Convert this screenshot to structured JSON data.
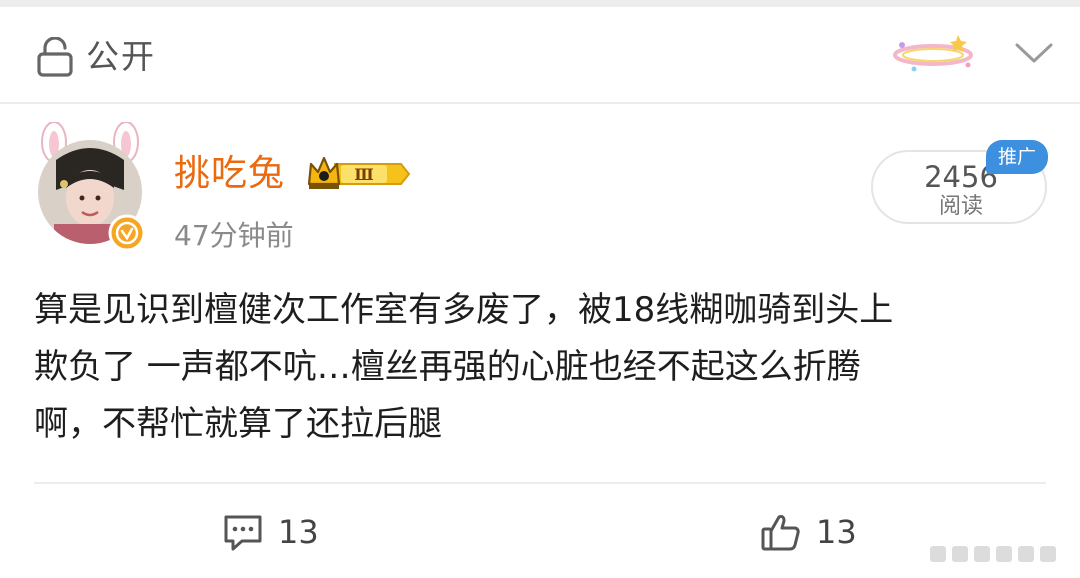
{
  "header": {
    "visibility_label": "公开",
    "lock_icon": "lock-icon",
    "collapse_icon": "chevron-down-icon"
  },
  "author": {
    "name": "挑吃兔",
    "level_badge": "Ⅲ",
    "time": "47分钟前",
    "name_color": "#eb6a10"
  },
  "stats": {
    "read_count": "2456",
    "read_label": "阅读",
    "promo_tag": "推广"
  },
  "post": {
    "lines": [
      "算是见识到檀健次工作室有多废了，被18线糊咖骑到头上",
      "欺负了 一声都不吭…檀丝再强的心脏也经不起这么折腾",
      "啊，不帮忙就算了还拉后腿"
    ]
  },
  "actions": {
    "comment_count": "13",
    "like_count": "13"
  },
  "colors": {
    "accent_orange": "#eb6a10",
    "promo_blue": "#3d8fe0"
  }
}
